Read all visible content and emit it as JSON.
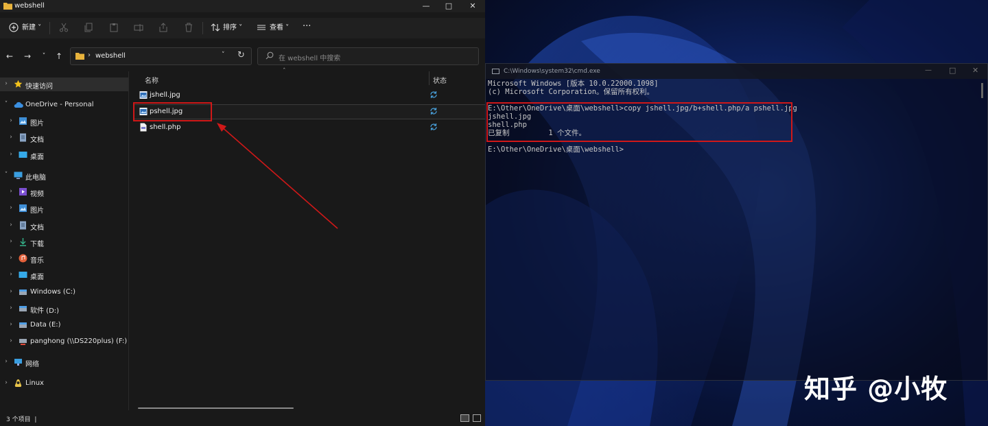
{
  "explorer": {
    "title": "webshell",
    "toolbar": {
      "new_label": "新建",
      "sort_label": "排序",
      "view_label": "查看",
      "more_label": "···"
    },
    "address": {
      "path": "webshell"
    },
    "search": {
      "placeholder": "在 webshell 中搜索"
    },
    "columns": {
      "name": "名称",
      "status": "状态"
    },
    "sidebar": [
      {
        "label": "快速访问",
        "icon": "star-icon"
      },
      {
        "label": "OneDrive - Personal",
        "icon": "cloud-icon"
      },
      {
        "label": "图片",
        "icon": "pictures-icon"
      },
      {
        "label": "文档",
        "icon": "documents-icon"
      },
      {
        "label": "桌面",
        "icon": "desktop-icon"
      },
      {
        "label": "此电脑",
        "icon": "pc-icon"
      },
      {
        "label": "视频",
        "icon": "videos-icon"
      },
      {
        "label": "图片",
        "icon": "pictures-icon"
      },
      {
        "label": "文档",
        "icon": "documents-icon"
      },
      {
        "label": "下载",
        "icon": "download-icon"
      },
      {
        "label": "音乐",
        "icon": "music-icon"
      },
      {
        "label": "桌面",
        "icon": "desktop-icon"
      },
      {
        "label": "Windows (C:)",
        "icon": "drive-icon"
      },
      {
        "label": "软件 (D:)",
        "icon": "drive-icon"
      },
      {
        "label": "Data (E:)",
        "icon": "drive-icon"
      },
      {
        "label": "panghong (\\\\DS220plus) (F:)",
        "icon": "network-drive-icon"
      },
      {
        "label": "网络",
        "icon": "network-icon"
      },
      {
        "label": "Linux",
        "icon": "linux-icon"
      }
    ],
    "files": [
      {
        "name": "jshell.jpg",
        "icon": "image-file-icon"
      },
      {
        "name": "pshell.jpg",
        "icon": "image-file-icon"
      },
      {
        "name": "shell.php",
        "icon": "php-file-icon"
      }
    ],
    "status": {
      "count": "3 个项目"
    }
  },
  "cmd": {
    "title": "C:\\Windows\\system32\\cmd.exe",
    "lines": [
      "Microsoft Windows [版本 10.0.22000.1098]",
      "(c) Microsoft Corporation。保留所有权利。",
      "",
      "E:\\Other\\OneDrive\\桌面\\webshell>copy jshell.jpg/b+shell.php/a pshell.jpg",
      "jshell.jpg",
      "shell.php",
      "已复制         1 个文件。",
      "",
      "E:\\Other\\OneDrive\\桌面\\webshell>"
    ]
  },
  "watermark": "知乎 @小牧",
  "colors": {
    "highlight": "#d01818",
    "sync": "#4aa3df"
  }
}
